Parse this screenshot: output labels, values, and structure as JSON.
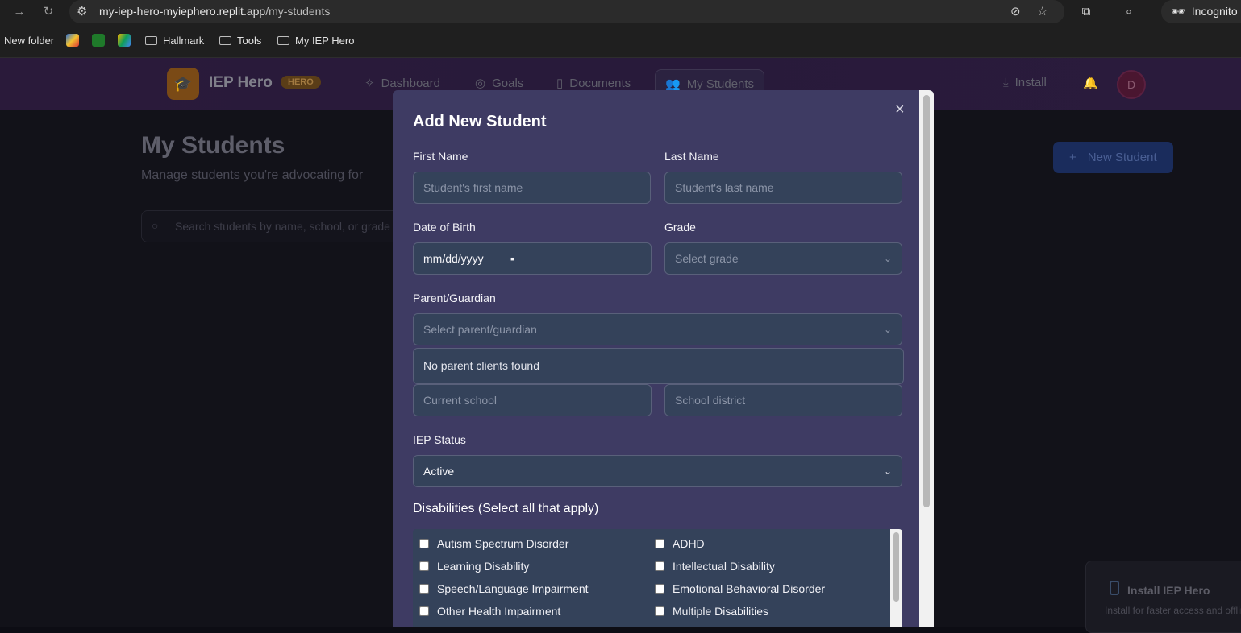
{
  "browser": {
    "url_host": "my-iep-hero-myiephero.replit.app",
    "url_path": "/my-students",
    "incognito_label": "Incognito",
    "bookmarks": [
      "New folder",
      "Hallmark",
      "Tools",
      "My IEP Hero"
    ]
  },
  "header": {
    "brand": "IEP Hero",
    "badge": "HERO",
    "nav": [
      "Dashboard",
      "Goals",
      "Documents",
      "My Students"
    ],
    "install": "Install",
    "avatar_initial": "D"
  },
  "page": {
    "title": "My Students",
    "subtitle": "Manage students you're advocating for",
    "new_student": "New Student",
    "search_placeholder": "Search students by name, school, or grade"
  },
  "toast": {
    "title": "Install IEP Hero",
    "subtitle": "Install for faster access and offline"
  },
  "modal": {
    "title": "Add New Student",
    "first_name_label": "First Name",
    "first_name_placeholder": "Student's first name",
    "last_name_label": "Last Name",
    "last_name_placeholder": "Student's last name",
    "dob_label": "Date of Birth",
    "dob_value": "mm/dd/yyyy",
    "grade_label": "Grade",
    "grade_placeholder": "Select grade",
    "parent_label": "Parent/Guardian",
    "parent_placeholder": "Select parent/guardian",
    "parent_empty": "No parent clients found",
    "school_placeholder": "Current school",
    "district_placeholder": "School district",
    "iep_status_label": "IEP Status",
    "iep_status_value": "Active",
    "disabilities_title": "Disabilities (Select all that apply)",
    "disabilities": [
      "Autism Spectrum Disorder",
      "ADHD",
      "Learning Disability",
      "Intellectual Disability",
      "Speech/Language Impairment",
      "Emotional Behavioral Disorder",
      "Other Health Impairment",
      "Multiple Disabilities"
    ]
  }
}
